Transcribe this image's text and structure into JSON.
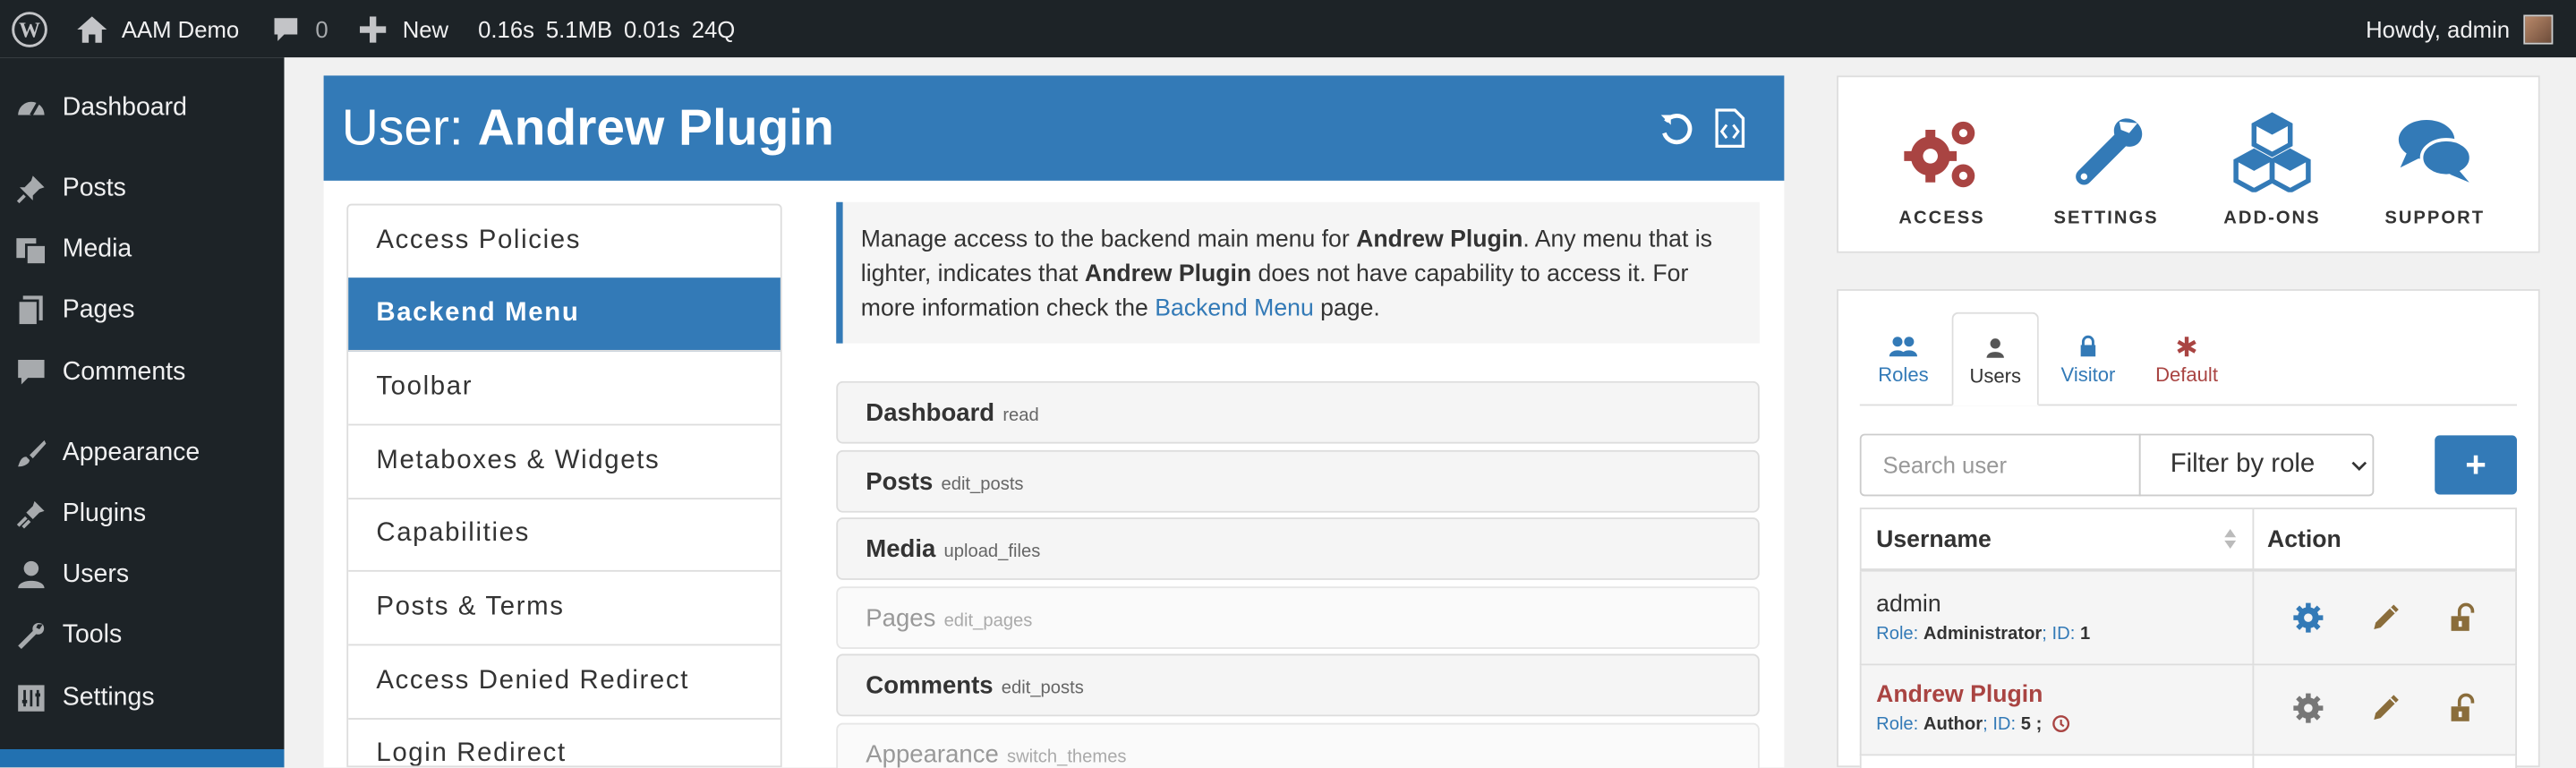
{
  "adminbar": {
    "site_name": "AAM Demo",
    "comments_count": "0",
    "new_label": "New",
    "stats": [
      "0.16s",
      "5.1MB",
      "0.01s",
      "24Q"
    ],
    "howdy": "Howdy, admin"
  },
  "sidebar": {
    "items": [
      {
        "label": "Dashboard",
        "icon": "dashboard-icon"
      },
      {
        "label": "Posts",
        "icon": "pin-icon"
      },
      {
        "label": "Media",
        "icon": "media-icon"
      },
      {
        "label": "Pages",
        "icon": "pages-icon"
      },
      {
        "label": "Comments",
        "icon": "comment-icon"
      },
      {
        "label": "Appearance",
        "icon": "brush-icon"
      },
      {
        "label": "Plugins",
        "icon": "plugin-icon"
      },
      {
        "label": "Users",
        "icon": "user-icon"
      },
      {
        "label": "Tools",
        "icon": "wrench-icon"
      },
      {
        "label": "Settings",
        "icon": "settings-icon"
      }
    ]
  },
  "header": {
    "prefix": "User:",
    "subject": "Andrew Plugin"
  },
  "features": [
    "Access Policies",
    "Backend Menu",
    "Toolbar",
    "Metaboxes & Widgets",
    "Capabilities",
    "Posts & Terms",
    "Access Denied Redirect",
    "Login Redirect"
  ],
  "info": {
    "p1": "Manage access to the backend main menu for ",
    "subject": "Andrew Plugin",
    "p2": ". Any menu that is lighter, indicates that ",
    "subject2": "Andrew Plugin",
    "p3": " does not have capability to access it. For more information check the ",
    "link": "Backend Menu",
    "p4": " page."
  },
  "menu_rows": [
    {
      "label": "Dashboard",
      "cap": "read",
      "restricted": false
    },
    {
      "label": "Posts",
      "cap": "edit_posts",
      "restricted": false
    },
    {
      "label": "Media",
      "cap": "upload_files",
      "restricted": false
    },
    {
      "label": "Pages",
      "cap": "edit_pages",
      "restricted": true
    },
    {
      "label": "Comments",
      "cap": "edit_posts",
      "restricted": false
    },
    {
      "label": "Appearance",
      "cap": "switch_themes",
      "restricted": true
    }
  ],
  "top_panel": [
    {
      "label": "ACCESS",
      "icon": "gears-icon"
    },
    {
      "label": "SETTINGS",
      "icon": "wrench-icon"
    },
    {
      "label": "ADD-ONS",
      "icon": "cubes-icon"
    },
    {
      "label": "SUPPORT",
      "icon": "chat-icon"
    }
  ],
  "subject_tabs": [
    {
      "label": "Roles",
      "icon": "roles-icon"
    },
    {
      "label": "Users",
      "icon": "user-icon",
      "active": true
    },
    {
      "label": "Visitor",
      "icon": "lock-icon"
    },
    {
      "label": "Default",
      "icon": "asterisk-icon"
    }
  ],
  "users": {
    "search_placeholder": "Search user",
    "filter_value": "Filter by role",
    "add_label": "+",
    "col_username": "Username",
    "col_action": "Action",
    "rows": [
      {
        "name": "admin",
        "role_label": "Role:",
        "role": "Administrator",
        "id_label": "ID:",
        "id": "1",
        "selected": false
      },
      {
        "name": "Andrew Plugin",
        "role_label": "Role:",
        "role": "Author",
        "id_label": "ID:",
        "id": "5",
        "id_suffix": ";",
        "selected": true
      }
    ]
  },
  "colors": {
    "primary": "#337ab7",
    "danger": "#a94442",
    "addon_gold": "#8a6d3b",
    "adminbar": "#1d2327"
  }
}
